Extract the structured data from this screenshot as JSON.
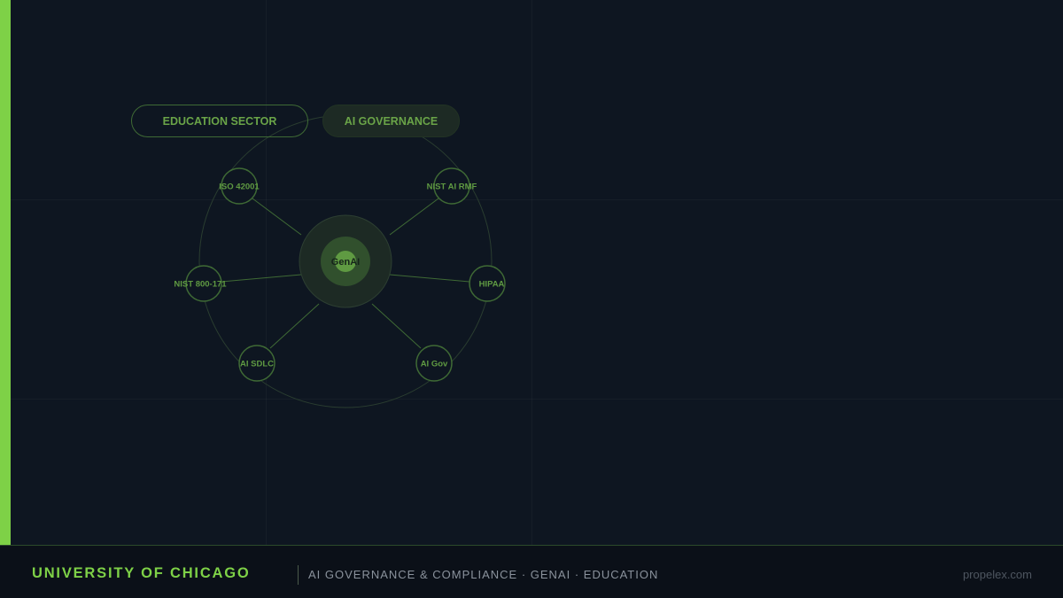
{
  "tags": {
    "sector": "EDUCATION SECTOR",
    "topic": "AI GOVERNANCE"
  },
  "diagram": {
    "center": "GenAI",
    "nodes": [
      "ISO 42001",
      "NIST AI RMF",
      "NIST 800-171",
      "HIPAA",
      "AI SDLC",
      "AI Gov"
    ]
  },
  "footer": {
    "brand": "UNIVERSITY OF CHICAGO",
    "tagline": "AI GOVERNANCE & COMPLIANCE · GENAI · EDUCATION",
    "site": "propelex.com"
  },
  "colors": {
    "accent": "#7ed147",
    "background": "#0e1621",
    "node_stroke": "#3f6a35"
  }
}
